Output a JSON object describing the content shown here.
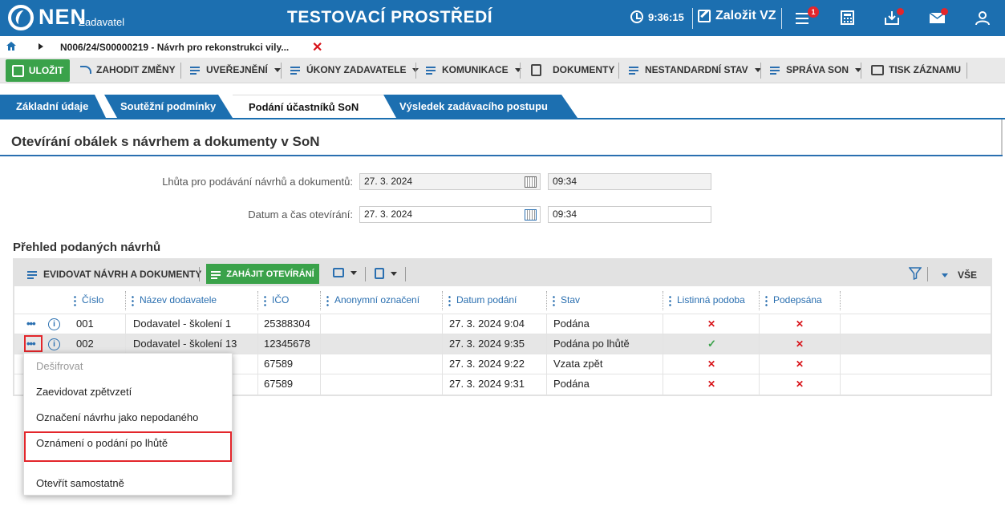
{
  "topbar": {
    "logo_text": "NEN",
    "logo_sub": "Zadavatel",
    "env_title": "TESTOVACÍ PROSTŘEDÍ",
    "time": "9:36:15",
    "create_vz": "Založit VZ",
    "notif_count": "1",
    "accent_color": "#1c6fb0",
    "badge_color": "#e3262b"
  },
  "breadcrumb": {
    "text": "N006/24/S00000219 - Návrh pro rekonstrukci vily...",
    "close": "✕"
  },
  "toolbar": {
    "save_label": "ULOŽIT",
    "discard_label": "ZAHODIT ZMĚNY",
    "publish_label": "UVEŘEJNĚNÍ",
    "acts_label": "ÚKONY ZADAVATELE",
    "comm_label": "KOMUNIKACE",
    "docs_label": "DOKUMENTY",
    "nonstd_label": "NESTANDARDNÍ STAV",
    "manage_label": "SPRÁVA SON",
    "print_label": "TISK ZÁZNAMU"
  },
  "tabs": [
    {
      "label": "Základní údaje"
    },
    {
      "label": "Soutěžní podmínky"
    },
    {
      "label": "Podání účastníků SoN"
    },
    {
      "label": "Výsledek zadávacího postupu"
    }
  ],
  "section": {
    "title": "Otevírání obálek s návrhem a dokumenty v SoN",
    "deadline_label": "Lhůta pro podávání návrhů a dokumentů:",
    "deadline_date": "27. 3. 2024",
    "deadline_time": "09:34",
    "opening_label": "Datum a čas otevírání:",
    "opening_date": "27. 3. 2024",
    "opening_time": "09:34"
  },
  "overview": {
    "title": "Přehled podaných návrhů",
    "register_label": "EVIDOVAT NÁVRH A DOKUMENTY",
    "start_label": "ZAHÁJIT OTEVÍRÁNÍ",
    "filter_all": "VŠE",
    "columns": [
      "Číslo",
      "Název dodavatele",
      "IČO",
      "Anonymní označení",
      "Datum podání",
      "Stav",
      "Listinná podoba",
      "Podepsána"
    ],
    "rows": [
      {
        "num": "001",
        "name": "Dodavatel - školení 1",
        "ico": "25388304",
        "anon": "",
        "date": "27. 3. 2024 9:04",
        "status": "Podána",
        "paper": "✕",
        "signed": "✕"
      },
      {
        "num": "002",
        "name": "Dodavatel - školení 13",
        "ico": "12345678",
        "anon": "",
        "date": "27. 3. 2024 9:35",
        "status": "Podána po lhůtě",
        "paper": "✓",
        "signed": "✕"
      },
      {
        "num": "",
        "name": "",
        "ico": "67589",
        "anon": "",
        "date": "27. 3. 2024 9:22",
        "status": "Vzata zpět",
        "paper": "✕",
        "signed": "✕"
      },
      {
        "num": "",
        "name": "",
        "ico": "67589",
        "anon": "",
        "date": "27. 3. 2024 9:31",
        "status": "Podána",
        "paper": "✕",
        "signed": "✕"
      }
    ]
  },
  "context_menu": {
    "items": [
      {
        "label": "Dešifrovat",
        "disabled": true
      },
      {
        "label": "Zaevidovat zpětvzetí"
      },
      {
        "label": "Označení návrhu jako nepodaného"
      },
      {
        "label": "Oznámení o podání po lhůtě"
      },
      {
        "label": "Otevřít samostatně"
      }
    ]
  }
}
